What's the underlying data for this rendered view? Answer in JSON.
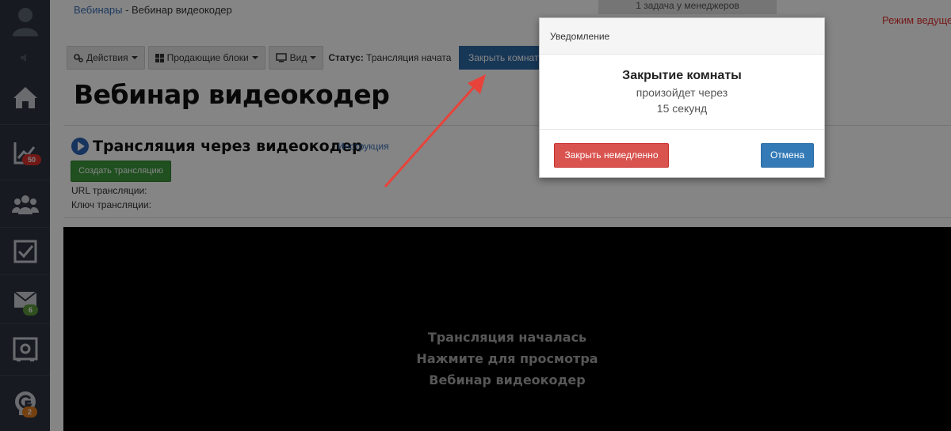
{
  "breadcrumb": {
    "root": "Вебинары",
    "separator": " - ",
    "current": "Вебинар видеокодер"
  },
  "header": {
    "tasks": "1 задача у менеджеров",
    "mode": "Режим ведущего"
  },
  "toolbar": {
    "actions_label": "Действия",
    "blocks_label": "Продающие блоки",
    "view_label": "Вид",
    "status_label": "Статус:",
    "status_value": "Трансляция начата",
    "close_room_label": "Закрыть комнату"
  },
  "page": {
    "title": "Вебинар видеокодер"
  },
  "stream": {
    "title": "Трансляция через видеокодер",
    "instruction_link": "Инструкция",
    "create_button": "Создать трансляцию",
    "url_label": "URL трансляции:",
    "key_label": "Ключ трансляции:"
  },
  "video": {
    "line1": "Трансляция началась",
    "line2": "Нажмите для просмотра",
    "line3": "Вебинар видеокодер"
  },
  "sidebar": {
    "badges": {
      "stats": "50",
      "mail": "6",
      "app": "2"
    },
    "colors": {
      "stats_badge": "#d9302c",
      "mail_badge": "#5a9a3a",
      "app_badge": "#e07b20"
    }
  },
  "modal": {
    "header": "Уведомление",
    "title": "Закрытие комнаты",
    "line1": "произойдет через",
    "line2": "15 секунд",
    "close_now": "Закрыть немедленно",
    "cancel": "Отмена"
  },
  "colors": {
    "accent": "#337ab7",
    "danger": "#d9534f",
    "success": "#3f9a3f",
    "sidebar": "#2d3540"
  },
  "icons": [
    "user-icon",
    "volume-icon",
    "home-icon",
    "chart-icon",
    "users-icon",
    "checkbox-icon",
    "mail-icon",
    "safe-icon",
    "app-logo-icon",
    "gears-icon",
    "grid-icon",
    "monitor-icon",
    "play-icon"
  ]
}
